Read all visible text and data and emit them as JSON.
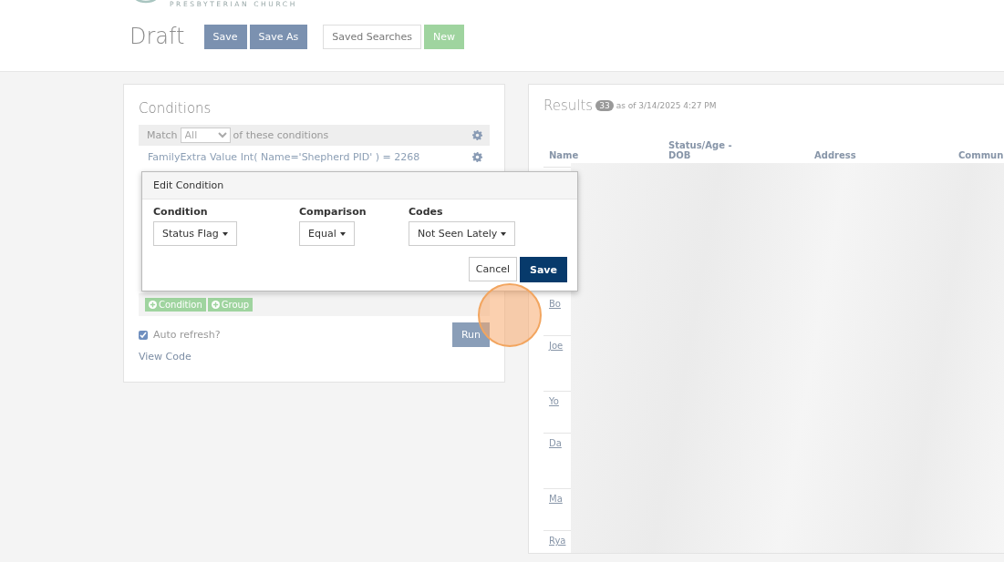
{
  "header": {
    "org_name": "PRESBYTERIAN CHURCH",
    "title": "Draft",
    "buttons": [
      {
        "label": "Save",
        "kind": "primary"
      },
      {
        "label": "Save As",
        "kind": "primary"
      },
      {
        "label": "Saved Searches",
        "kind": "default"
      },
      {
        "label": "New",
        "kind": "success"
      }
    ]
  },
  "conditions": {
    "title": "Conditions",
    "match_label": "Match",
    "match_value": "All",
    "match_suffix": "of these conditions",
    "items": [
      "FamilyExtra Value Int( Name='Shepherd PID' ) = 2268"
    ],
    "add_buttons": [
      "Condition",
      "Group"
    ],
    "auto_refresh": {
      "label": "Auto refresh?",
      "checked": true
    },
    "run": "Run",
    "view_code": "View Code"
  },
  "edit_condition": {
    "title": "Edit Condition",
    "fields": [
      {
        "label": "Condition",
        "value": "Status Flag"
      },
      {
        "label": "Comparison",
        "value": "Equal"
      },
      {
        "label": "Codes",
        "value": "Not Seen Lately"
      }
    ],
    "cancel": "Cancel",
    "save": "Save"
  },
  "results": {
    "title": "Results",
    "count": "33",
    "as_of": "as of 3/14/2025 4:27 PM",
    "columns": [
      "Name",
      "Status/Age - DOB",
      "Address",
      "Commun"
    ],
    "rows": [
      {
        "name": "Bo"
      },
      {
        "name": "Joe"
      },
      {
        "name": "Yo"
      },
      {
        "name": "Da"
      },
      {
        "name": "Ma"
      },
      {
        "name": "Rya"
      }
    ]
  }
}
